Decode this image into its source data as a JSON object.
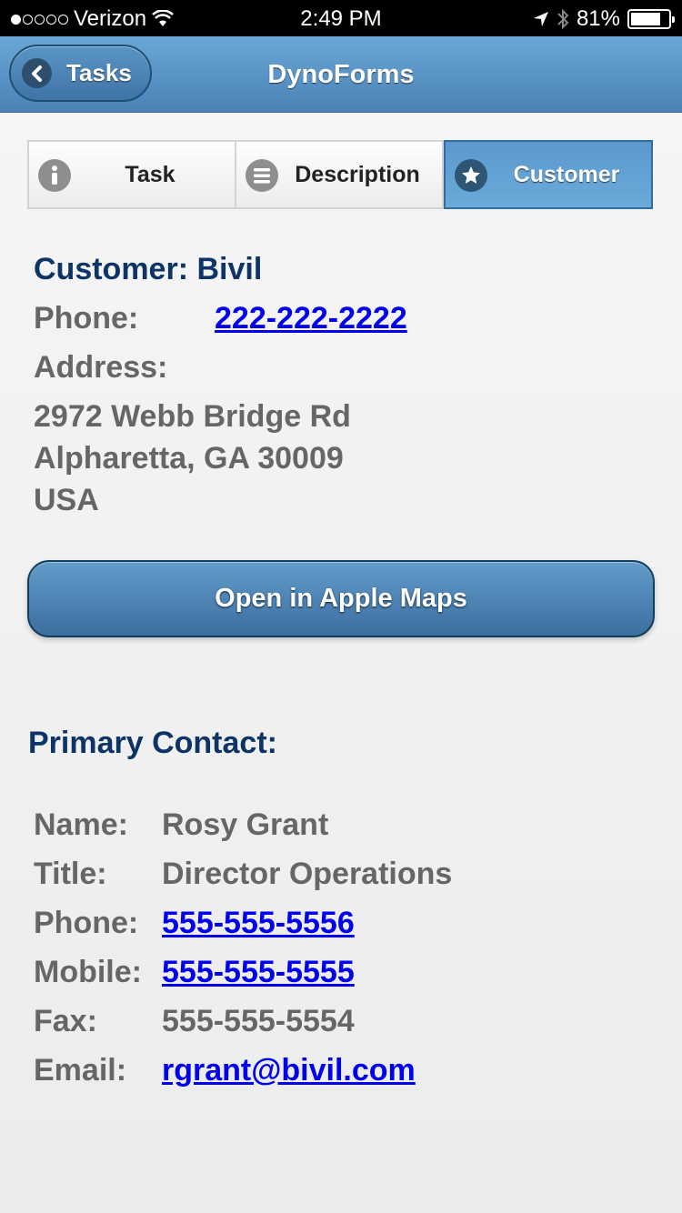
{
  "status_bar": {
    "signal_bars_filled": 1,
    "signal_bars_total": 5,
    "carrier": "Verizon",
    "time": "2:49 PM",
    "battery_percent": "81%",
    "battery_level": 0.81
  },
  "header": {
    "back_label": "Tasks",
    "title": "DynoForms"
  },
  "tabs": [
    {
      "label": "Task",
      "icon": "info-icon",
      "active": false
    },
    {
      "label": "Description",
      "icon": "list-icon",
      "active": false
    },
    {
      "label": "Customer",
      "icon": "star-icon",
      "active": true
    }
  ],
  "customer": {
    "heading": "Customer: Bivil",
    "phone_label": "Phone:",
    "phone": "222-222-2222",
    "address_label": "Address:",
    "address_lines": [
      "2972 Webb Bridge Rd",
      "Alpharetta, GA 30009",
      "USA"
    ],
    "maps_button": "Open in Apple Maps"
  },
  "primary_contact": {
    "heading": "Primary Contact:",
    "rows": [
      {
        "label": "Name:",
        "value": "Rosy Grant",
        "link": false
      },
      {
        "label": "Title:",
        "value": "Director Operations",
        "link": false
      },
      {
        "label": "Phone:",
        "value": "555-555-5556",
        "link": true
      },
      {
        "label": "Mobile:",
        "value": "555-555-5555",
        "link": true
      },
      {
        "label": "Fax:",
        "value": "555-555-5554",
        "link": false
      },
      {
        "label": "Email:",
        "value": "rgrant@bivil.com",
        "link": true
      }
    ]
  },
  "colors": {
    "header_blue": "#5a95c6",
    "heading_navy": "#0c3466",
    "link_blue": "#0000ee",
    "text_gray": "#666666"
  }
}
